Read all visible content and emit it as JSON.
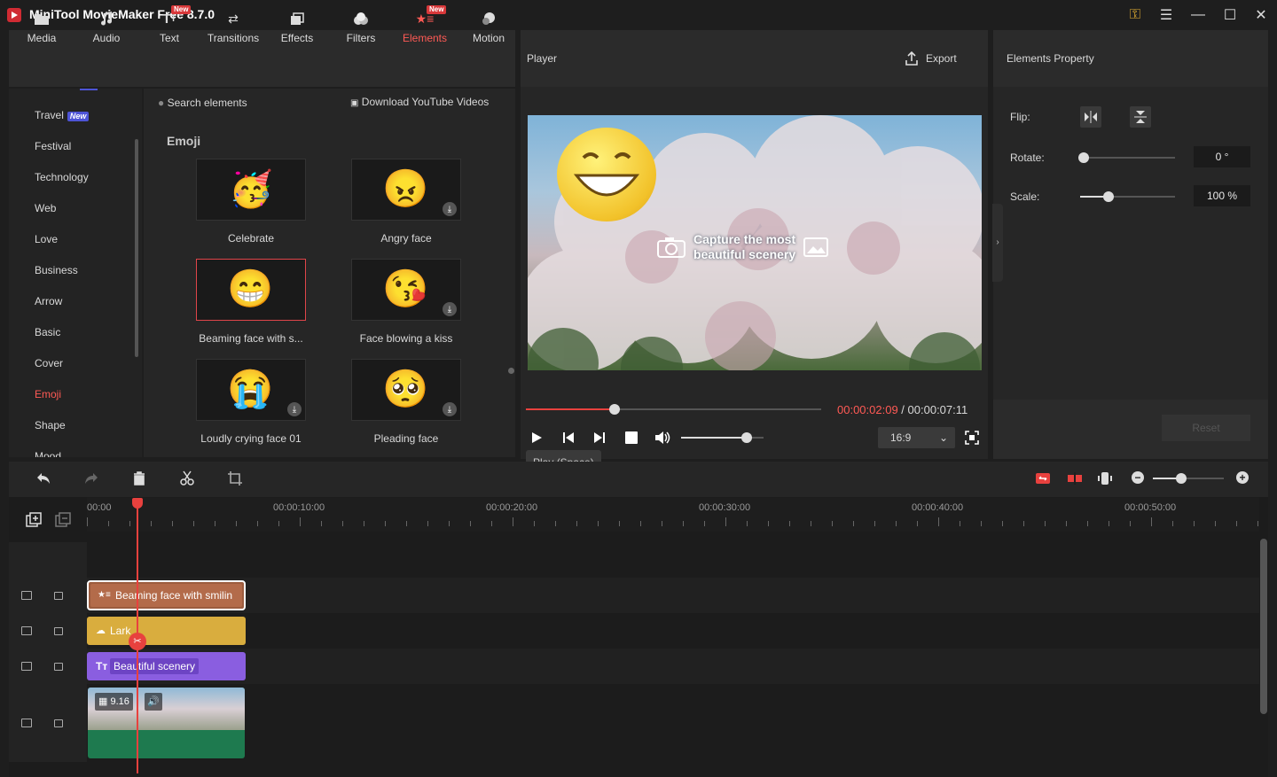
{
  "app": {
    "title": "MiniTool MovieMaker Free 8.7.0"
  },
  "toolbar": {
    "tabs": [
      {
        "label": "Media",
        "icon": "folder-icon"
      },
      {
        "label": "Audio",
        "icon": "music-icon"
      },
      {
        "label": "Text",
        "icon": "text-icon",
        "badge": "New"
      },
      {
        "label": "Transitions",
        "icon": "transitions-icon"
      },
      {
        "label": "Effects",
        "icon": "effects-icon"
      },
      {
        "label": "Filters",
        "icon": "filters-icon"
      },
      {
        "label": "Elements",
        "icon": "elements-icon",
        "badge": "New",
        "active": true
      },
      {
        "label": "Motion",
        "icon": "motion-icon"
      }
    ]
  },
  "categories": {
    "items": [
      "Travel",
      "Festival",
      "Technology",
      "Web",
      "Love",
      "Business",
      "Arrow",
      "Basic",
      "Cover",
      "Emoji",
      "Shape",
      "Mood"
    ],
    "travel_badge": "New",
    "active": "Emoji"
  },
  "elements": {
    "search_placeholder": "Search elements",
    "download_label": "Download YouTube Videos",
    "section_title": "Emoji",
    "items": [
      {
        "label": "Celebrate",
        "emoji": "🥳"
      },
      {
        "label": "Angry face",
        "emoji": "😠"
      },
      {
        "label": "Beaming face with s...",
        "emoji": "😁"
      },
      {
        "label": "Face blowing a kiss",
        "emoji": "😘"
      },
      {
        "label": "Loudly crying face 01",
        "emoji": "😭"
      },
      {
        "label": "Pleading face",
        "emoji": "🥺"
      }
    ]
  },
  "player": {
    "title": "Player",
    "export_label": "Export",
    "overlay_text_line1": "Capture the most",
    "overlay_text_line2": "beautiful scenery",
    "current_time": "00:00:02:09",
    "separator": " / ",
    "total_time": "00:00:07:11",
    "progress": 0.3,
    "volume": 0.8,
    "aspect_ratio": "16:9",
    "tooltip": "Play (Space)"
  },
  "properties": {
    "title": "Elements Property",
    "flip_label": "Flip:",
    "rotate_label": "Rotate:",
    "rotate_value": "0 °",
    "rotate_level": 0.0,
    "scale_label": "Scale:",
    "scale_value": "100 %",
    "scale_level": 0.3,
    "reset_label": "Reset"
  },
  "timeline": {
    "ruler_labels": [
      "00:00",
      "00:00:10:00",
      "00:00:20:00",
      "00:00:30:00",
      "00:00:40:00",
      "00:00:50:00"
    ],
    "zoom_level": 0.4,
    "clips": {
      "element": "Beaming face with smilin",
      "audio": "Lark",
      "text": "Beautiful scenery",
      "video": "9.16"
    }
  },
  "colors": {
    "accent": "#ff5a55",
    "element_clip": "#9c5c3e",
    "audio_clip": "#d9ad3e",
    "text_clip": "#8a5ee0",
    "video_clip": "#1e7a4f"
  }
}
